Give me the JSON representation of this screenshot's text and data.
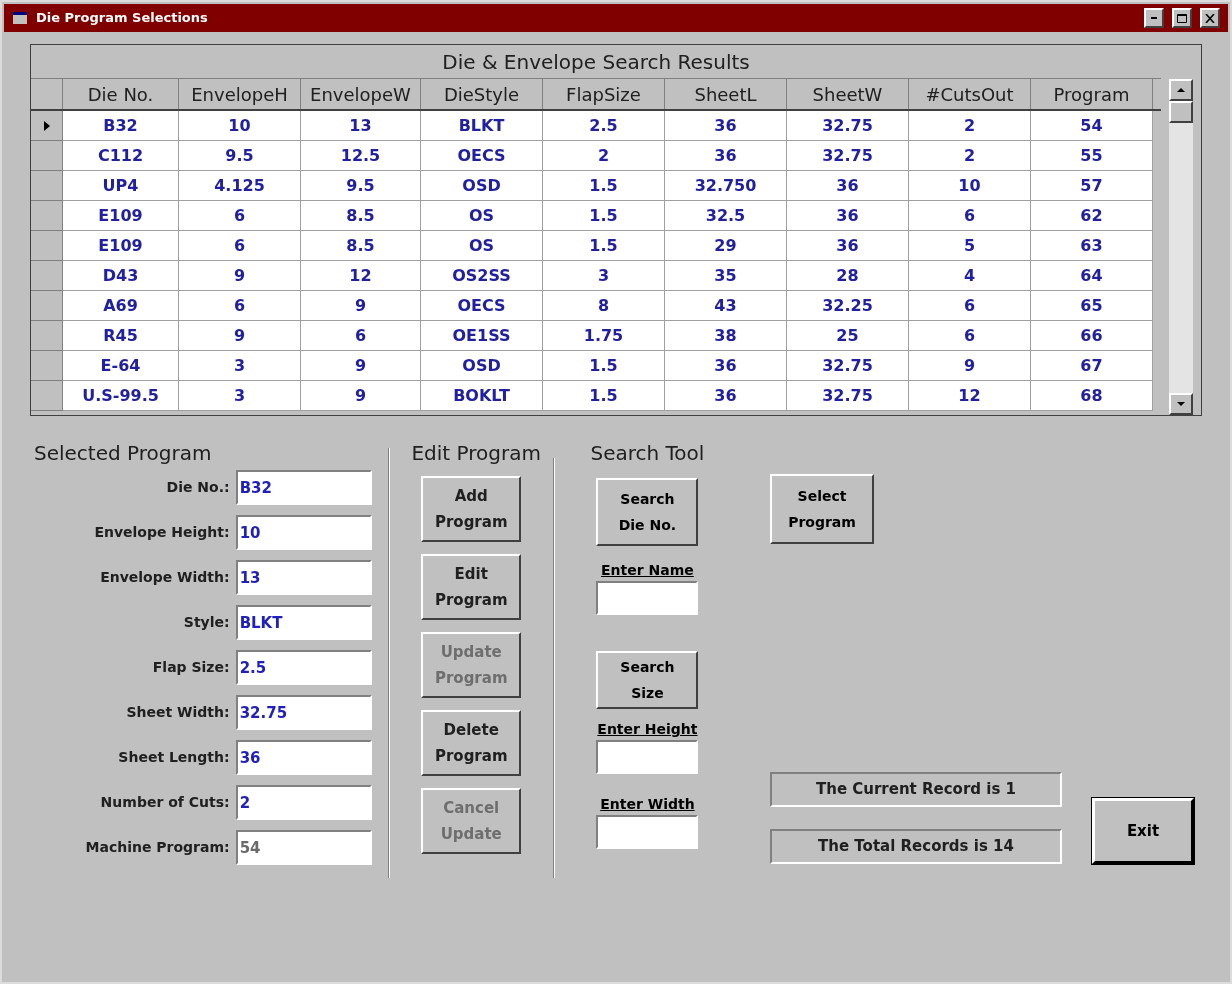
{
  "window": {
    "title": "Die Program Selections"
  },
  "grid": {
    "caption": "Die & Envelope Search Results",
    "columns": [
      "Die No.",
      "EnvelopeH",
      "EnvelopeW",
      "DieStyle",
      "FlapSize",
      "SheetL",
      "SheetW",
      "#CutsOut",
      "Program"
    ],
    "rows": [
      {
        "selected": true,
        "cells": [
          "B32",
          "10",
          "13",
          "BLKT",
          "2.5",
          "36",
          "32.75",
          "2",
          "54"
        ]
      },
      {
        "selected": false,
        "cells": [
          "C112",
          "9.5",
          "12.5",
          "OECS",
          "2",
          "36",
          "32.75",
          "2",
          "55"
        ]
      },
      {
        "selected": false,
        "cells": [
          "UP4",
          "4.125",
          "9.5",
          "OSD",
          "1.5",
          "32.750",
          "36",
          "10",
          "57"
        ]
      },
      {
        "selected": false,
        "cells": [
          "E109",
          "6",
          "8.5",
          "OS",
          "1.5",
          "32.5",
          "36",
          "6",
          "62"
        ]
      },
      {
        "selected": false,
        "cells": [
          "E109",
          "6",
          "8.5",
          "OS",
          "1.5",
          "29",
          "36",
          "5",
          "63"
        ]
      },
      {
        "selected": false,
        "cells": [
          "D43",
          "9",
          "12",
          "OS2SS",
          "3",
          "35",
          "28",
          "4",
          "64"
        ]
      },
      {
        "selected": false,
        "cells": [
          "A69",
          "6",
          "9",
          "OECS",
          "8",
          "43",
          "32.25",
          "6",
          "65"
        ]
      },
      {
        "selected": false,
        "cells": [
          "R45",
          "9",
          "6",
          "OE1SS",
          "1.75",
          "38",
          "25",
          "6",
          "66"
        ]
      },
      {
        "selected": false,
        "cells": [
          "E-64",
          "3",
          "9",
          "OSD",
          "1.5",
          "36",
          "32.75",
          "9",
          "67"
        ]
      },
      {
        "selected": false,
        "cells": [
          "U.S-99.5",
          "3",
          "9",
          "BOKLT",
          "1.5",
          "36",
          "32.75",
          "12",
          "68"
        ]
      }
    ]
  },
  "selected_program": {
    "title": "Selected Program",
    "fields": [
      {
        "label": "Die No.:",
        "value": "B32",
        "disabled": false
      },
      {
        "label": "Envelope Height:",
        "value": "10",
        "disabled": false
      },
      {
        "label": "Envelope Width:",
        "value": "13",
        "disabled": false
      },
      {
        "label": "Style:",
        "value": "BLKT",
        "disabled": false
      },
      {
        "label": "Flap Size:",
        "value": "2.5",
        "disabled": false
      },
      {
        "label": "Sheet Width:",
        "value": "32.75",
        "disabled": false
      },
      {
        "label": "Sheet Length:",
        "value": "36",
        "disabled": false
      },
      {
        "label": "Number of Cuts:",
        "value": "2",
        "disabled": false
      },
      {
        "label": "Machine Program:",
        "value": "54",
        "disabled": true
      }
    ]
  },
  "edit_program": {
    "title": "Edit Program",
    "buttons": [
      {
        "label": "Add Program",
        "disabled": false
      },
      {
        "label": "Edit Program",
        "disabled": false
      },
      {
        "label": "Update Program",
        "disabled": true
      },
      {
        "label": "Delete Program",
        "disabled": false
      },
      {
        "label": "Cancel Update",
        "disabled": true
      }
    ]
  },
  "search_tool": {
    "title": "Search Tool",
    "search_die_button": "Search Die No.",
    "name_label": "Enter Name",
    "search_size_button": "Search Size",
    "height_label": "Enter Height",
    "width_label": "Enter Width"
  },
  "select_program_button": "Select Program",
  "status": [
    "The Current Record is 1",
    "The Total Records is 14"
  ],
  "exit_button": "Exit"
}
